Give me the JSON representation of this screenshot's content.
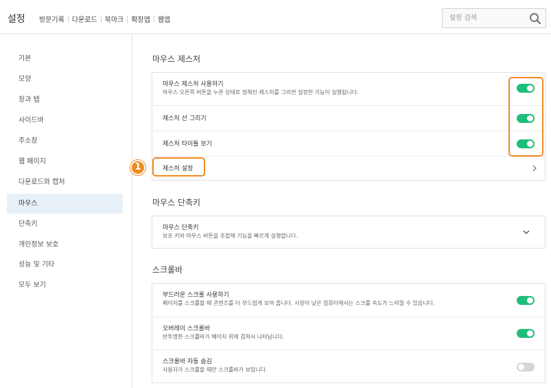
{
  "header": {
    "title": "설정",
    "nav": [
      "방문기록",
      "다운로드",
      "북마크",
      "확장앱",
      "웹앱"
    ],
    "search_placeholder": "설정 검색"
  },
  "sidebar": {
    "items": [
      {
        "label": "기본",
        "active": false
      },
      {
        "label": "모양",
        "active": false
      },
      {
        "label": "창과 탭",
        "active": false
      },
      {
        "label": "사이드바",
        "active": false
      },
      {
        "label": "주소창",
        "active": false
      },
      {
        "label": "웹 페이지",
        "active": false
      },
      {
        "label": "다운로드와 캡처",
        "active": false
      },
      {
        "label": "마우스",
        "active": true
      },
      {
        "label": "단축키",
        "active": false
      },
      {
        "label": "개인정보 보호",
        "active": false
      },
      {
        "label": "성능 및 기타",
        "active": false
      },
      {
        "label": "모두 보기",
        "active": false
      }
    ]
  },
  "sections": {
    "gesture": {
      "title": "마우스 제스처",
      "use_label": "마우스 제스처 사용하기",
      "use_desc": "마우스 오른쪽 버튼을 누른 상태로 정해진 제스처를 그리면 설정한 기능이 실행됩니다.",
      "use_on": true,
      "draw_label": "제스처 선 그리기",
      "draw_on": true,
      "tooltip_label": "제스처 타이틀 보기",
      "tooltip_on": true,
      "settings_label": "제스처 설정"
    },
    "shortcut": {
      "title": "마우스 단축키",
      "label": "마우스 단축키",
      "desc": "보조 키와 마우스 버튼을 조합해 기능을 빠르게 실행합니다."
    },
    "scroll": {
      "title": "스크롤바",
      "smooth_label": "부드러운 스크롤 사용하기",
      "smooth_desc": "페이지를 스크롤할 때 콘텐츠를 더 부드럽게 보여 줍니다. 사양이 낮은 컴퓨터에서는 스크롤 속도가 느려질 수 있습니다.",
      "smooth_on": true,
      "overlay_label": "오버레이 스크롤바",
      "overlay_desc": "반투명한 스크롤바가 페이지 위에 겹쳐서 나타납니다.",
      "overlay_on": true,
      "autohide_label": "스크롤바 자동 숨김",
      "autohide_desc": "사용자가 스크롤할 때만 스크롤바가 보입니다.",
      "autohide_on": false
    }
  },
  "annotation": {
    "callout_number": "1",
    "accent": "#ef8a23"
  },
  "colors": {
    "toggle_on": "#1fbd7a",
    "toggle_off": "#d6d6d6",
    "active_bg": "#e8f0f8"
  }
}
